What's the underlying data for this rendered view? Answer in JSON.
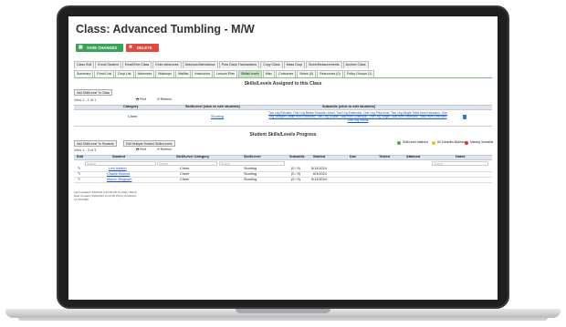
{
  "page": {
    "title": "Class: Advanced Tumbling - M/W"
  },
  "actions": {
    "save": "SAVE CHANGES",
    "delete": "DELETE"
  },
  "tabs_row1": [
    "Class Roll",
    "Enroll Student",
    "Email/Text Class",
    "Enter Absences",
    "Absence/Attendance",
    "Post Class Transactions",
    "Copy Class",
    "Mass Drop",
    "Sizes/Measurements",
    "Archive Class"
  ],
  "tabs_row2": [
    "Summary",
    "Enroll List",
    "Drop List",
    "Absences",
    "Makeups",
    "Waitlist",
    "Instructors",
    "Lesson Plan",
    "Skills/Levels",
    "Misc",
    "Costumes",
    "Notes (0)",
    "Resources (0)",
    "Policy Groups (1)"
  ],
  "assigned": {
    "heading": "Skills/Levels Assigned to this Class",
    "add_button": "Add Skill/Level To Class",
    "view": "View 1 - 1 of 1",
    "print": "Print",
    "refresh": "Refresh",
    "columns": [
      "Category",
      "Skill/Level (click to edit students)",
      "Subskills (click to edit students)"
    ],
    "rows": [
      {
        "category": "Cheer",
        "skill": "Stunting",
        "subskills": "Two Leg Elevator, One Leg Below Shoulder Level, Two Leg Extension, One Leg Prep level, Two Leg Single Twist from Extension, One Leg Straight Cradle from Extended, Two Leg Double Twist from Extension, One Leg Single Twist from Extended, Twist from Extended One Leg Stunts"
      }
    ]
  },
  "progress": {
    "heading": "Student Skills/Levels Progress",
    "add_students": "Add Skill/Level To Students",
    "edit_multiple": "Edit Multiple Student Skills/Levels",
    "view": "View 1 - 3 of 3",
    "print": "Print",
    "refresh": "Refresh",
    "legend": [
      "Skill/Level Attained",
      "All Subskills Attained",
      "Missing Subskills"
    ],
    "columns": [
      "Edit",
      "Student",
      "Skill/Level Category",
      "Skill/Level",
      "Subskills",
      "Started",
      "Due",
      "Tested",
      "Attained",
      "Notes"
    ],
    "search": "Search",
    "rows": [
      {
        "student": "Lexi Ashton",
        "category": "Cheer",
        "skill": "Stunting",
        "subskills": "(0 / 9)",
        "started": "5/13/2024"
      },
      {
        "student": "Charlie Barrow",
        "category": "Cheer",
        "skill": "Stunting",
        "subskills": "(0 / 9)",
        "started": "6/3/2024"
      },
      {
        "student": "Mason Bingham",
        "category": "Cheer",
        "skill": "Stunting",
        "subskills": "(0 / 9)",
        "started": "5/13/2024"
      }
    ]
  },
  "footer": [
    "Last Updated: 9/9/2024 3:26:00 PM by Hilary Bandt",
    "Date Created: 8/29/2024 11:04:00 PM by Amdts/etc",
    "Id: 5672480"
  ],
  "colors": {
    "save": "#3aa35a",
    "delete": "#e2483d",
    "attained": "#44b044",
    "all_sub": "#f0c020",
    "missing": "#e03030",
    "link": "#1a55c0"
  }
}
